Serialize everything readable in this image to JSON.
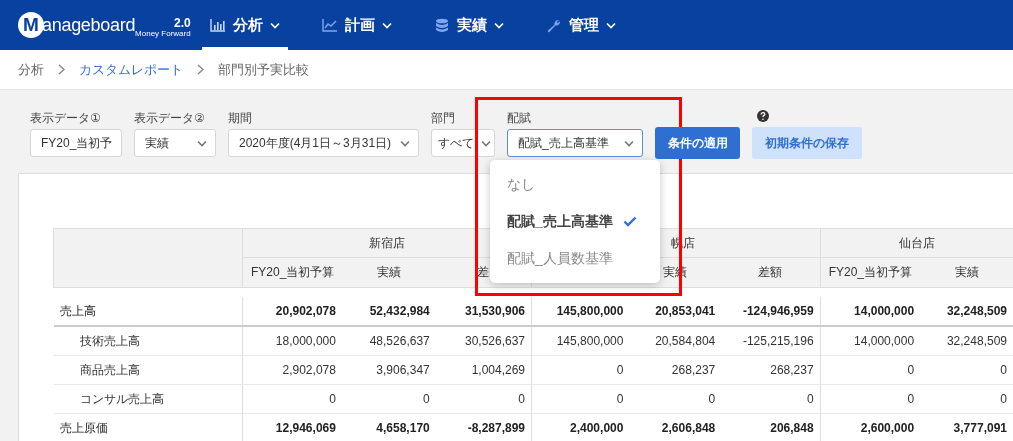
{
  "header": {
    "logo": {
      "text": "Manageboard",
      "version": "2.0",
      "tagline": "Money Forward"
    },
    "tabs": [
      {
        "label": "分析",
        "selected": true
      },
      {
        "label": "計画",
        "selected": false
      },
      {
        "label": "実績",
        "selected": false
      },
      {
        "label": "管理",
        "selected": false
      }
    ]
  },
  "breadcrumb": [
    {
      "label": "分析",
      "link": false
    },
    {
      "label": "カスタムレポート",
      "link": true
    },
    {
      "label": "部門別予実比較",
      "link": false
    }
  ],
  "filters": [
    {
      "label": "表示データ①",
      "value": "FY20_当初予",
      "dropdown": false,
      "focused": false
    },
    {
      "label": "表示データ②",
      "value": "実績",
      "dropdown": true,
      "focused": false
    },
    {
      "label": "期間",
      "value": "2020年度(4月1日～3月31日)",
      "dropdown": true,
      "focused": false
    },
    {
      "label": "部門",
      "value": "すべて",
      "dropdown": true,
      "focused": false
    },
    {
      "label": "配賦",
      "value": "配賦_売上高基準",
      "dropdown": true,
      "focused": true
    }
  ],
  "buttons": [
    {
      "label": "条件の適用",
      "kind": "primary"
    },
    {
      "label": "初期条件の保存",
      "kind": "secondary"
    }
  ],
  "dropdown_menu": {
    "options": [
      {
        "label": "なし",
        "selected": false
      },
      {
        "label": "配賦_売上高基準",
        "selected": true
      },
      {
        "label": "配賦_人員数基準",
        "selected": false
      }
    ]
  },
  "table": {
    "groups": [
      {
        "name": "新宿店",
        "columns": [
          {
            "label": "FY20_当初予算"
          },
          {
            "label": "実績"
          },
          {
            "label": "差"
          }
        ]
      },
      {
        "name": "幌店",
        "columns": [
          {},
          {
            "label": "実績"
          },
          {
            "label": "差額"
          }
        ]
      },
      {
        "name": "仙台店",
        "columns": [
          {
            "label": "FY20_当初予算"
          },
          {
            "label": "実績"
          }
        ]
      }
    ],
    "rows": [
      {
        "label": "売上高",
        "kind": "total",
        "cells": [
          "20,902,078",
          "52,432,984",
          "31,530,906",
          "145,800,000",
          "20,853,041",
          "-124,946,959",
          "14,000,000",
          "32,248,509"
        ]
      },
      {
        "label": "技術売上高",
        "kind": "detail",
        "cells": [
          "18,000,000",
          "48,526,637",
          "30,526,637",
          "145,800,000",
          "20,584,804",
          "-125,215,196",
          "14,000,000",
          "32,248,509"
        ]
      },
      {
        "label": "商品売上高",
        "kind": "detail",
        "cells": [
          "2,902,078",
          "3,906,347",
          "1,004,269",
          "0",
          "268,237",
          "268,237",
          "0",
          "0"
        ]
      },
      {
        "label": "コンサル売上高",
        "kind": "detail",
        "cells": [
          "0",
          "0",
          "0",
          "0",
          "0",
          "0",
          "0",
          "0"
        ]
      },
      {
        "label": "売上原価",
        "kind": "total",
        "cells": [
          "12,946,069",
          "4,658,170",
          "-8,287,899",
          "2,400,000",
          "2,606,848",
          "206,848",
          "2,600,000",
          "3,777,091"
        ]
      }
    ]
  }
}
